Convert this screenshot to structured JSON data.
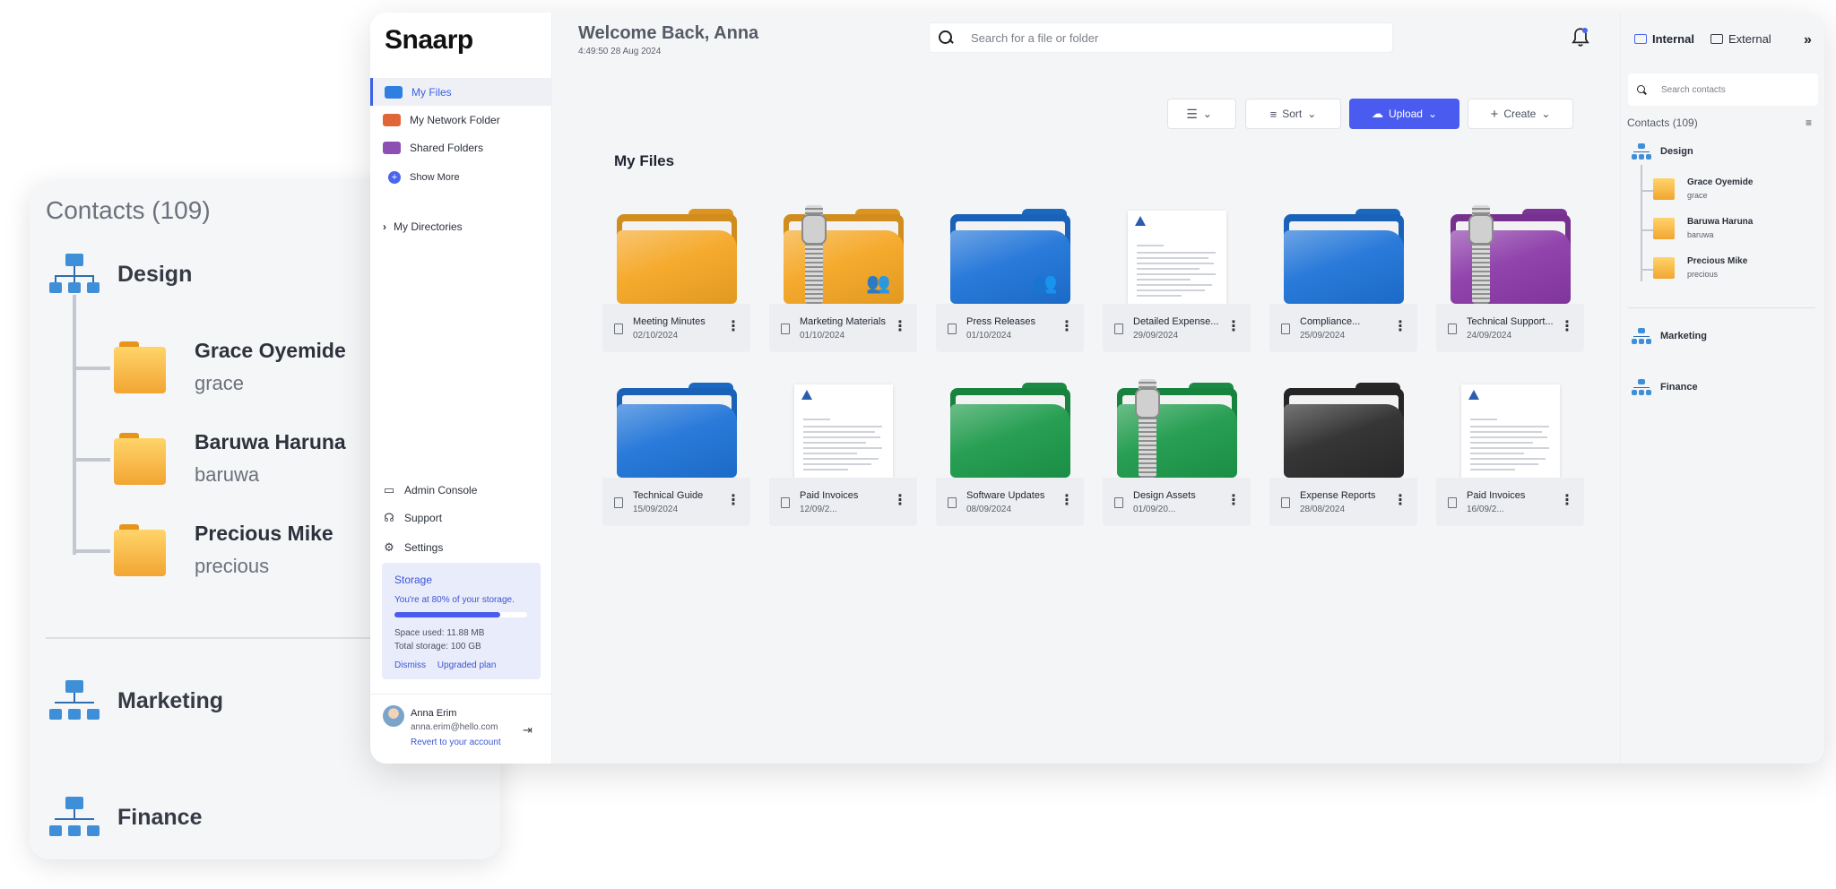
{
  "background_contacts": {
    "title": "Contacts (109)",
    "groups": [
      "Design",
      "Marketing",
      "Finance"
    ],
    "contacts": [
      {
        "name": "Grace Oyemide",
        "user": "grace"
      },
      {
        "name": "Baruwa Haruna",
        "user": "baruwa"
      },
      {
        "name": "Precious Mike",
        "user": "precious"
      }
    ]
  },
  "app": {
    "logo": "Snaarp",
    "greeting": "Welcome Back, Anna",
    "datetime": "4:49:50 28 Aug 2024",
    "search_placeholder": "Search for a file or folder"
  },
  "sidebar": {
    "items": [
      {
        "label": "My Files",
        "icon": "folder-icon",
        "color": "#2f7fe0"
      },
      {
        "label": "My Network Folder",
        "icon": "network-folder-icon",
        "color": "#e0663a"
      },
      {
        "label": "Shared Folders",
        "icon": "shared-folder-icon",
        "color": "#8e4fb5"
      }
    ],
    "show_more": "Show More",
    "my_directories": "My Directories",
    "bottom": [
      {
        "label": "Admin Console",
        "icon": "laptop-icon"
      },
      {
        "label": "Support",
        "icon": "headset-icon"
      },
      {
        "label": "Settings",
        "icon": "gear-icon"
      }
    ],
    "storage": {
      "title": "Storage",
      "message": "You're at 80% of your storage.",
      "percent": 80,
      "space_used": "Space used: 11.88 MB",
      "total": "Total storage: 100 GB",
      "dismiss": "Dismiss",
      "upgrade": "Upgraded plan"
    },
    "user": {
      "name": "Anna Erim",
      "email": "anna.erim@hello.com",
      "revert": "Revert to your account"
    }
  },
  "toolbar": {
    "sort": "Sort",
    "upload": "Upload",
    "create": "Create"
  },
  "section_title": "My Files",
  "files": [
    {
      "name": "Meeting Minutes",
      "date": "02/10/2024",
      "kind": "folder",
      "color": "#f5a623",
      "badge": ""
    },
    {
      "name": "Marketing Materials",
      "date": "01/10/2024",
      "kind": "zip",
      "color": "#f5a623",
      "badge": "group"
    },
    {
      "name": "Press Releases",
      "date": "01/10/2024",
      "kind": "folder",
      "color": "#1e73d8",
      "badge": "group"
    },
    {
      "name": "Detailed Expense...",
      "date": "29/09/2024",
      "kind": "doc",
      "color": "",
      "badge": ""
    },
    {
      "name": "Compliance...",
      "date": "25/09/2024",
      "kind": "folder",
      "color": "#1e73d8",
      "badge": ""
    },
    {
      "name": "Technical Support...",
      "date": "24/09/2024",
      "kind": "zip",
      "color": "#8b3aa8",
      "badge": ""
    },
    {
      "name": "Technical Guide",
      "date": "15/09/2024",
      "kind": "folder",
      "color": "#1e73d8",
      "badge": ""
    },
    {
      "name": "Paid Invoices",
      "date": "12/09/2...",
      "kind": "doc",
      "color": "",
      "badge": ""
    },
    {
      "name": "Software Updates",
      "date": "08/09/2024",
      "kind": "folder",
      "color": "#1c9a4a",
      "badge": ""
    },
    {
      "name": "Design Assets",
      "date": "01/09/20...",
      "kind": "zip",
      "color": "#1c9a4a",
      "badge": ""
    },
    {
      "name": "Expense Reports",
      "date": "28/08/2024",
      "kind": "folder",
      "color": "#2b2b2b",
      "badge": ""
    },
    {
      "name": "Paid Invoices",
      "date": "16/09/2...",
      "kind": "doc",
      "color": "",
      "badge": ""
    }
  ],
  "right_panel": {
    "tabs": [
      "Internal",
      "External"
    ],
    "search_placeholder": "Search contacts",
    "count": "Contacts (109)",
    "groups": [
      "Design",
      "Marketing",
      "Finance"
    ],
    "contacts": [
      {
        "name": "Grace Oyemide",
        "user": "grace"
      },
      {
        "name": "Baruwa Haruna",
        "user": "baruwa"
      },
      {
        "name": "Precious Mike",
        "user": "precious"
      }
    ]
  },
  "colors": {
    "accent": "#4a5cf0",
    "folder_orange": "#f5a623"
  }
}
